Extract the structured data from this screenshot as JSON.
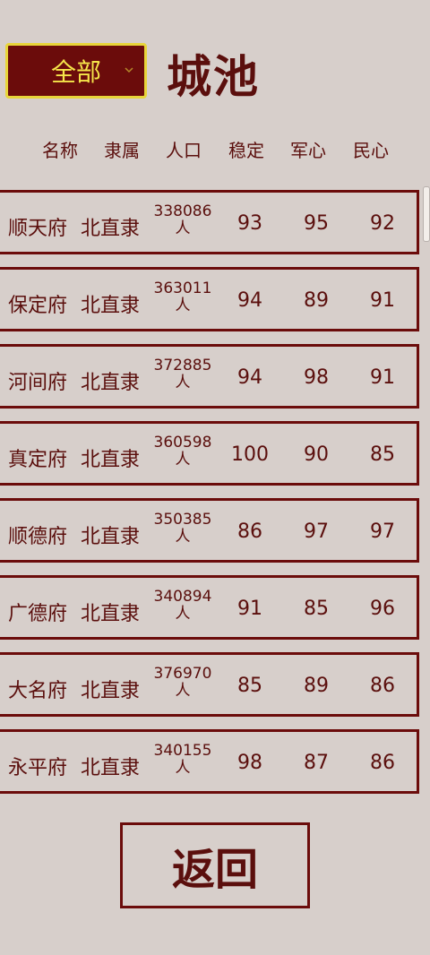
{
  "header": {
    "filter_label": "全部",
    "title": "城池"
  },
  "columns": {
    "name": "名称",
    "province": "隶属",
    "population": "人口",
    "stability": "稳定",
    "army_morale": "军心",
    "people_morale": "民心"
  },
  "rows": [
    {
      "name": "顺天府",
      "province": "北直隶",
      "pop_number": "338086",
      "pop_unit": "人",
      "stability": "93",
      "army": "95",
      "people": "92"
    },
    {
      "name": "保定府",
      "province": "北直隶",
      "pop_number": "363011",
      "pop_unit": "人",
      "stability": "94",
      "army": "89",
      "people": "91"
    },
    {
      "name": "河间府",
      "province": "北直隶",
      "pop_number": "372885",
      "pop_unit": "人",
      "stability": "94",
      "army": "98",
      "people": "91"
    },
    {
      "name": "真定府",
      "province": "北直隶",
      "pop_number": "360598",
      "pop_unit": "人",
      "stability": "100",
      "army": "90",
      "people": "85"
    },
    {
      "name": "顺德府",
      "province": "北直隶",
      "pop_number": "350385",
      "pop_unit": "人",
      "stability": "86",
      "army": "97",
      "people": "97"
    },
    {
      "name": "广德府",
      "province": "北直隶",
      "pop_number": "340894",
      "pop_unit": "人",
      "stability": "91",
      "army": "85",
      "people": "96"
    },
    {
      "name": "大名府",
      "province": "北直隶",
      "pop_number": "376970",
      "pop_unit": "人",
      "stability": "85",
      "army": "89",
      "people": "86"
    },
    {
      "name": "永平府",
      "province": "北直隶",
      "pop_number": "340155",
      "pop_unit": "人",
      "stability": "98",
      "army": "87",
      "people": "86"
    }
  ],
  "footer": {
    "back_label": "返回"
  },
  "colors": {
    "accent": "#6b0c0b",
    "select_text": "#f6e64a",
    "select_border": "#e8d53a",
    "background": "#d7cfcb"
  },
  "icons": {
    "select_chevron": "chevron-down-icon"
  }
}
